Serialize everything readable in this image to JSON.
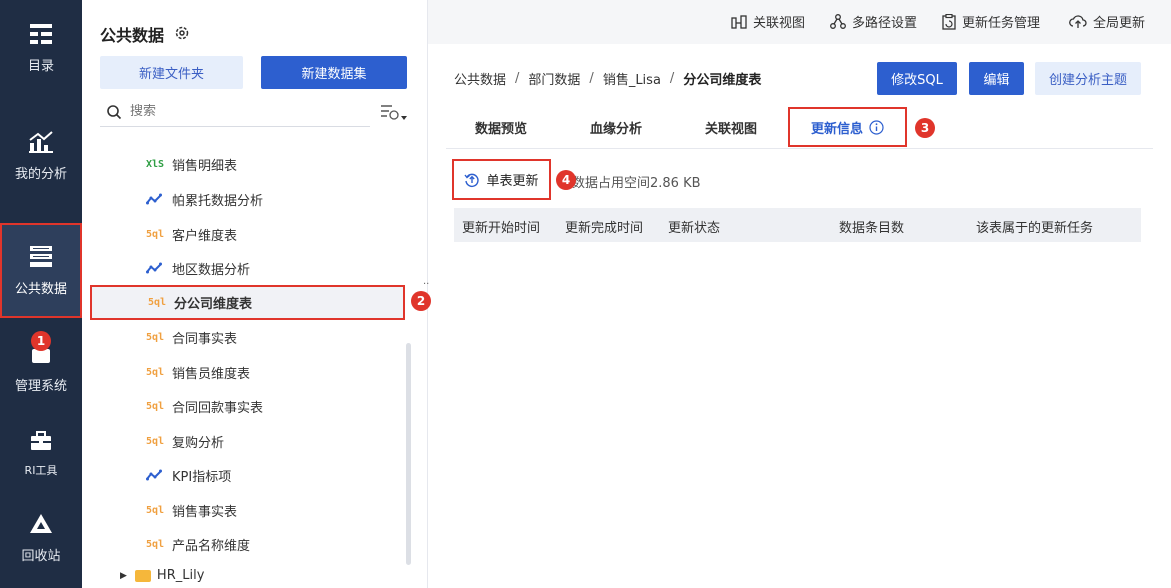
{
  "nav": {
    "items": [
      {
        "label": "目录",
        "icon": "catalog-icon"
      },
      {
        "label": "我的分析",
        "icon": "analysis-icon"
      },
      {
        "label": "公共数据",
        "icon": "public-data-icon",
        "active": true
      },
      {
        "label": "管理系统",
        "icon": "admin-icon"
      },
      {
        "label": "RI工具",
        "icon": "toolbox-icon"
      },
      {
        "label": "回收站",
        "icon": "recycle-icon"
      }
    ]
  },
  "panel": {
    "title": "公共数据",
    "new_folder_label": "新建文件夹",
    "new_dataset_label": "新建数据集",
    "search_placeholder": "搜索",
    "tree": [
      {
        "type": "xls",
        "icon_text": "XlS",
        "label": "销售明细表"
      },
      {
        "type": "analysis",
        "label": "帕累托数据分析"
      },
      {
        "type": "sql",
        "icon_text": "5ql",
        "label": "客户维度表"
      },
      {
        "type": "analysis",
        "label": "地区数据分析"
      },
      {
        "type": "sql",
        "icon_text": "5ql",
        "label": "分公司维度表",
        "selected": true
      },
      {
        "type": "sql",
        "icon_text": "5ql",
        "label": "合同事实表"
      },
      {
        "type": "sql",
        "icon_text": "5ql",
        "label": "销售员维度表"
      },
      {
        "type": "sql",
        "icon_text": "5ql",
        "label": "合同回款事实表"
      },
      {
        "type": "sql",
        "icon_text": "5ql",
        "label": "复购分析"
      },
      {
        "type": "analysis",
        "label": "KPI指标项"
      },
      {
        "type": "sql",
        "icon_text": "5ql",
        "label": "销售事实表"
      },
      {
        "type": "sql",
        "icon_text": "5ql",
        "label": "产品名称维度"
      }
    ],
    "folder_label": "HR_Lily"
  },
  "topbar": {
    "actions": [
      "关联视图",
      "多路径设置",
      "更新任务管理",
      "全局更新"
    ]
  },
  "breadcrumb": {
    "items": [
      "公共数据",
      "部门数据",
      "销售_Lisa"
    ],
    "current": "分公司维度表",
    "separator": "/"
  },
  "buttons": {
    "modify_sql": "修改SQL",
    "edit": "编辑",
    "create_theme": "创建分析主题"
  },
  "tabs": [
    "数据预览",
    "血缘分析",
    "关联视图",
    "更新信息"
  ],
  "update": {
    "single_update_label": "单表更新",
    "space_info": "数据占用空间2.86 KB",
    "columns": [
      "更新开始时间",
      "更新完成时间",
      "更新状态",
      "数据条目数",
      "该表属于的更新任务"
    ]
  },
  "badges": [
    "1",
    "2",
    "3",
    "4"
  ],
  "colors": {
    "nav_bg": "#1f2d44",
    "primary": "#2d5fcf",
    "highlight": "#e0352b"
  }
}
